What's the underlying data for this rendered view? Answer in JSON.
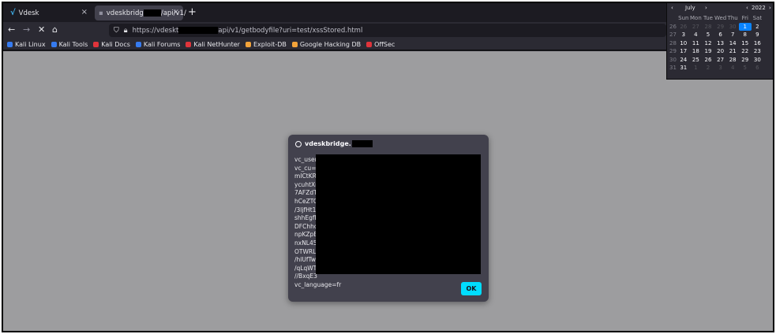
{
  "tabs": [
    {
      "title": "Vdesk",
      "active": false
    },
    {
      "title_pre": "vdeskbridg",
      "title_post": "/api/v1/",
      "active": true
    }
  ],
  "new_tab_symbol": "+",
  "close_symbol": "×",
  "toolbar": {
    "back": "←",
    "forward": "→",
    "stop": "✕",
    "home": "⌂",
    "url_pre": "https://vdeskt",
    "url_post": "api/v1/getbodyfile?uri=test/xssStored.html"
  },
  "bookmarks": [
    {
      "label": "Kali Linux",
      "color": "#367bf0"
    },
    {
      "label": "Kali Tools",
      "color": "#367bf0"
    },
    {
      "label": "Kali Docs",
      "color": "#e0343b"
    },
    {
      "label": "Kali Forums",
      "color": "#367bf0"
    },
    {
      "label": "Kali NetHunter",
      "color": "#e0343b"
    },
    {
      "label": "Exploit-DB",
      "color": "#f2a33a"
    },
    {
      "label": "Google Hacking DB",
      "color": "#f2a33a"
    },
    {
      "label": "OffSec",
      "color": "#e0343b"
    }
  ],
  "dialog": {
    "origin": "vdeskbridge.",
    "lines": [
      "vc_user",
      "vc_cu=U",
      "mICtKR",
      "ycuhtXr",
      "7AFZdT",
      "hCeZTC",
      "/3ljfHt1",
      "shhEgfE",
      "DFChho",
      "npKZpB",
      "nxNL45",
      "OTWRL",
      "/hlUfTw",
      "/qLqWT",
      "//BxqE3",
      "vc_language=fr"
    ],
    "ok_label": "OK"
  },
  "calendar": {
    "month": "July",
    "year": "2022",
    "prev": "‹",
    "next": "›",
    "days_of_week": [
      "Sun",
      "Mon",
      "Tue",
      "Wed",
      "Thu",
      "Fri",
      "Sat"
    ],
    "weeks": [
      {
        "wk": "26",
        "days": [
          "26",
          "27",
          "28",
          "29",
          "30",
          "1",
          "2"
        ]
      },
      {
        "wk": "27",
        "days": [
          "3",
          "4",
          "5",
          "6",
          "7",
          "8",
          "9"
        ]
      },
      {
        "wk": "28",
        "days": [
          "10",
          "11",
          "12",
          "13",
          "14",
          "15",
          "16"
        ]
      },
      {
        "wk": "29",
        "days": [
          "17",
          "18",
          "19",
          "20",
          "21",
          "22",
          "23"
        ]
      },
      {
        "wk": "30",
        "days": [
          "24",
          "25",
          "26",
          "27",
          "28",
          "29",
          "30"
        ]
      },
      {
        "wk": "31",
        "days": [
          "31",
          "1",
          "2",
          "3",
          "4",
          "5",
          "6"
        ]
      }
    ],
    "selected_day": "1",
    "accent_color": "#0a84ff"
  }
}
